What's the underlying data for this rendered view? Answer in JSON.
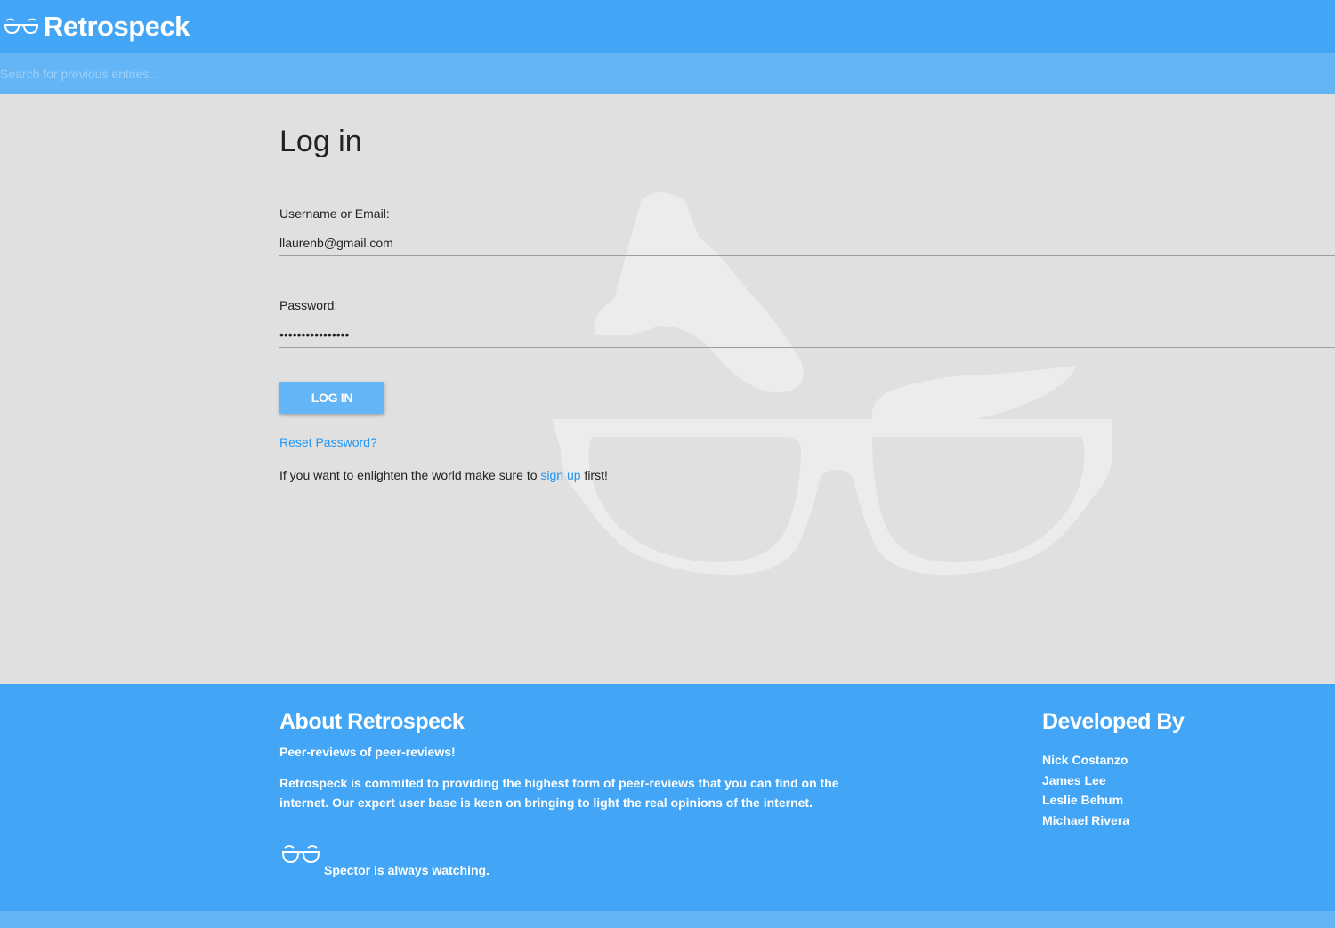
{
  "navbar": {
    "brand": "Retrospeck",
    "logo_icon": "glasses-icon"
  },
  "search": {
    "placeholder": "Search for previous entries.."
  },
  "login": {
    "title": "Log in",
    "username_label": "Username or Email:",
    "username_value": "llaurenb@gmail.com",
    "password_label": "Password:",
    "password_value": "••••••••••••••••",
    "submit_label": "LOG IN",
    "reset_link": "Reset Password?",
    "signup_prefix": "If you want to enlighten the world make sure to ",
    "signup_link": "sign up",
    "signup_suffix": " first!",
    "watermark_icon": "glasses-eyebrows-icon"
  },
  "footer": {
    "about_title": "About Retrospeck",
    "about_tagline": "Peer-reviews of peer-reviews!",
    "about_description": "Retrospeck is commited to providing the highest form of peer-reviews that you can find on the internet. Our expert user base is keen on bringing to light the real opinions of the internet.",
    "spector_icon": "glasses-icon",
    "spector_text": "Spector is always watching.",
    "developed_title": "Developed By",
    "developers": [
      "Nick Costanzo",
      "James Lee",
      "Leslie Behum",
      "Michael Rivera"
    ]
  },
  "colors": {
    "primary": "#42a5f5",
    "primary_light": "#64b5f6",
    "link": "#2196f3",
    "background": "#e0e0e0"
  }
}
